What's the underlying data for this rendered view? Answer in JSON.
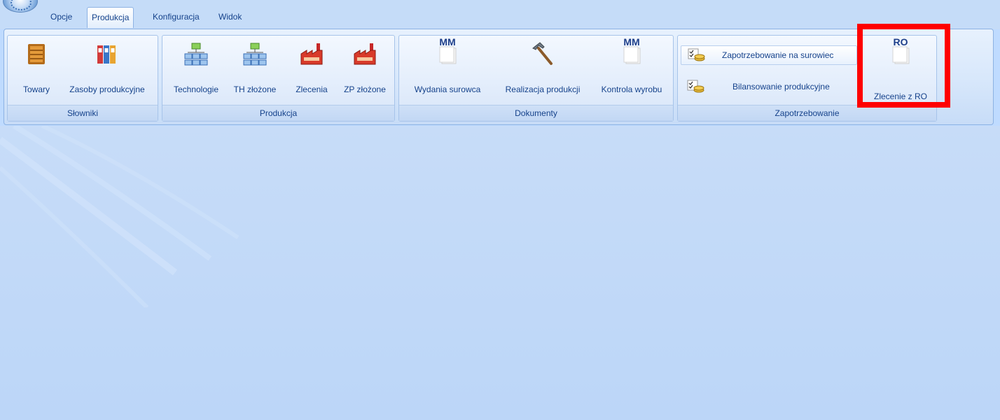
{
  "tabs": [
    {
      "label": "Opcje"
    },
    {
      "label": "Produkcja"
    },
    {
      "label": "Konfiguracja"
    },
    {
      "label": "Widok"
    }
  ],
  "groups": {
    "slowniki": {
      "label": "Słowniki",
      "buttons": [
        "Towary",
        "Zasoby produkcyjne"
      ]
    },
    "produkcja": {
      "label": "Produkcja",
      "buttons": [
        "Technologie",
        "TH złożone",
        "Zlecenia",
        "ZP złożone"
      ]
    },
    "dokumenty": {
      "label": "Dokumenty",
      "buttons": [
        "Wydania surowca",
        "Realizacja produkcji",
        "Kontrola wyrobu"
      ],
      "mm_text": "MM"
    },
    "zapotrzebowanie": {
      "label": "Zapotrzebowanie",
      "small_buttons": [
        "Zapotrzebowanie na surowiec",
        "Bilansowanie produkcyjne"
      ],
      "big_button": "Zlecenie z RO",
      "ro_text": "RO"
    }
  },
  "colors": {
    "highlight": "#ff0000",
    "text": "#15428b",
    "workspace": "#bfdbff"
  }
}
